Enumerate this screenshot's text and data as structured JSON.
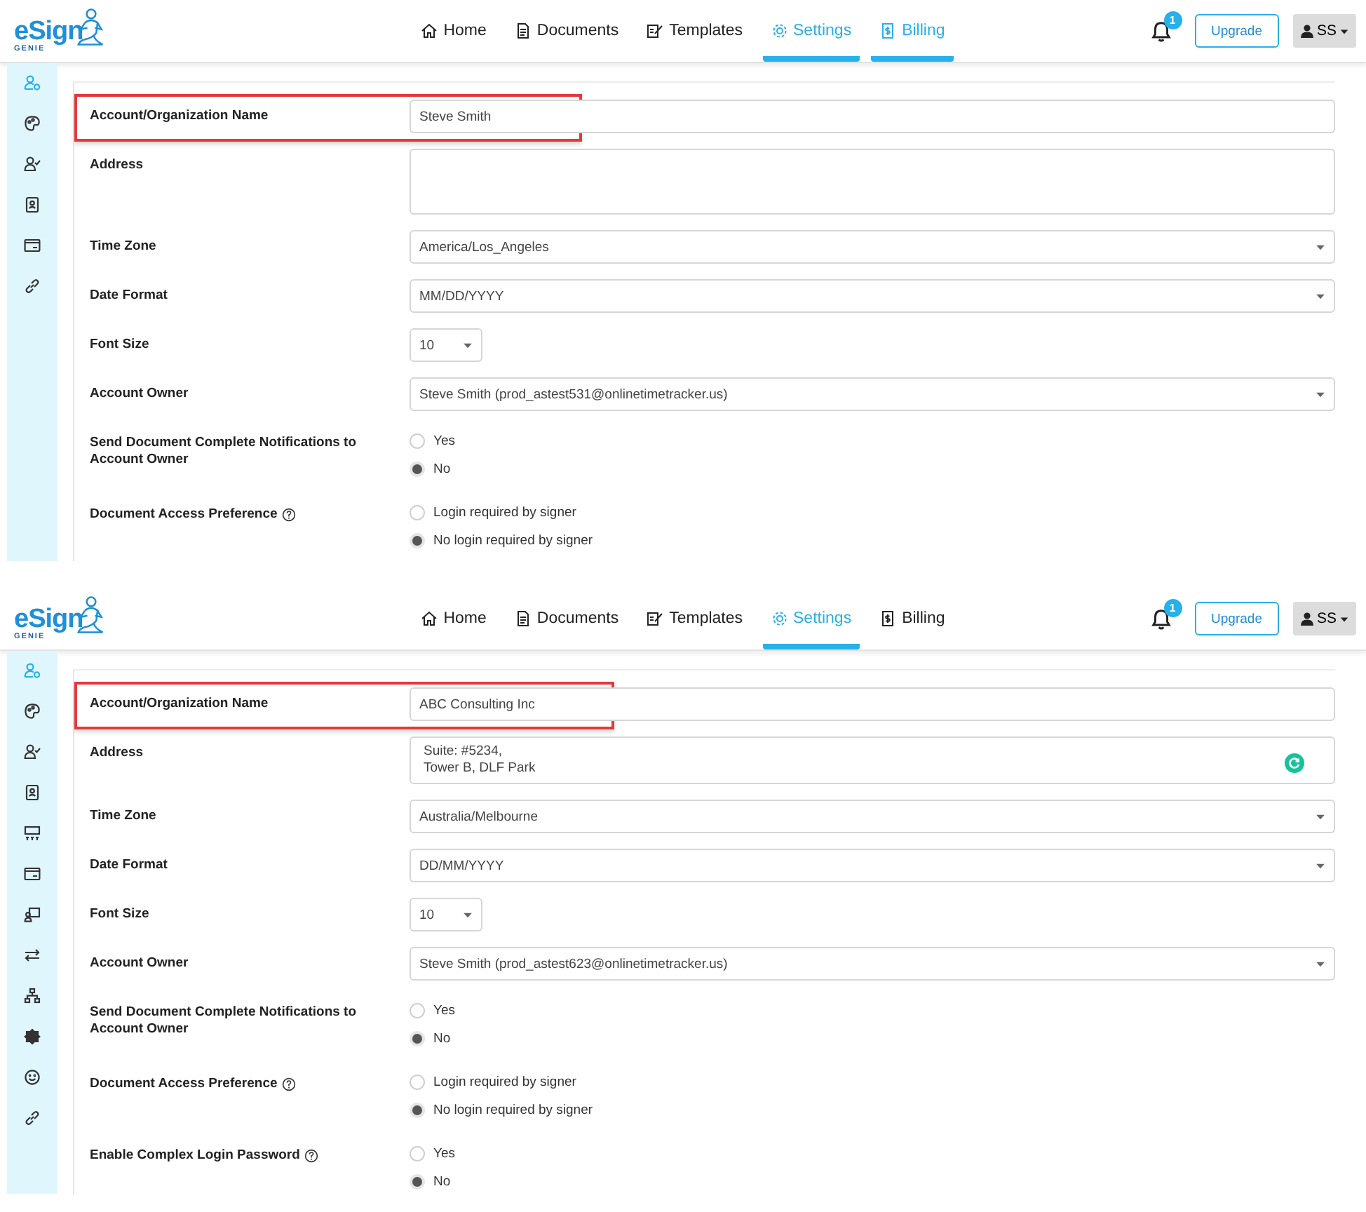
{
  "panels": [
    {
      "logo": {
        "name": "eSign",
        "tagline": "GENIE"
      },
      "nav": [
        {
          "kind": "home",
          "label": "Home",
          "selected": false
        },
        {
          "kind": "document",
          "label": "Documents",
          "selected": false
        },
        {
          "kind": "template",
          "label": "Templates",
          "selected": false
        },
        {
          "kind": "settings",
          "label": "Settings",
          "selected": true
        },
        {
          "kind": "billing",
          "label": "Billing",
          "selected": true
        }
      ],
      "notifications": "1",
      "upgrade": "Upgrade",
      "user": "SS",
      "sidebar": [
        {
          "kind": "user-gear",
          "selected": true
        },
        {
          "kind": "palette",
          "selected": false
        },
        {
          "kind": "user-check",
          "selected": false
        },
        {
          "kind": "contact",
          "selected": false
        },
        {
          "kind": "card",
          "selected": false
        },
        {
          "kind": "link",
          "selected": false
        }
      ],
      "fields": [
        {
          "kind": "text",
          "label": "Account/Organization Name",
          "value": "Steve Smith",
          "highlighted": true,
          "help": false
        },
        {
          "kind": "textarea",
          "label": "Address",
          "assist_badge": false,
          "highlighted": false,
          "help": false
        },
        {
          "kind": "select",
          "label": "Time Zone",
          "value": "America/Los_Angeles",
          "highlighted": false,
          "help": false
        },
        {
          "kind": "select",
          "label": "Date Format",
          "value": "MM/DD/YYYY",
          "highlighted": false,
          "help": false
        },
        {
          "kind": "small-select",
          "label": "Font Size",
          "value": "10",
          "highlighted": false,
          "help": false
        },
        {
          "kind": "select",
          "label": "Account Owner",
          "value": "Steve Smith (prod_astest531@onlinetimetracker.us)",
          "highlighted": false,
          "help": false
        },
        {
          "kind": "radio",
          "label": "Send Document Complete Notifications to Account Owner",
          "highlighted": false,
          "help": false,
          "options": [
            {
              "label": "Yes",
              "selected": false
            },
            {
              "label": "No",
              "selected": true
            }
          ]
        },
        {
          "kind": "radio",
          "label": "Document Access Preference",
          "highlighted": false,
          "help": true,
          "options": [
            {
              "label": "Login required by signer",
              "selected": false
            },
            {
              "label": "No login required by signer",
              "selected": true
            }
          ]
        }
      ]
    },
    {
      "logo": {
        "name": "eSign",
        "tagline": "GENIE"
      },
      "nav": [
        {
          "kind": "home",
          "label": "Home",
          "selected": false
        },
        {
          "kind": "document",
          "label": "Documents",
          "selected": false
        },
        {
          "kind": "template",
          "label": "Templates",
          "selected": false
        },
        {
          "kind": "settings",
          "label": "Settings",
          "selected": true
        },
        {
          "kind": "billing",
          "label": "Billing",
          "selected": false
        }
      ],
      "notifications": "1",
      "upgrade": "Upgrade",
      "user": "SS",
      "sidebar": [
        {
          "kind": "user-gear",
          "selected": true
        },
        {
          "kind": "palette",
          "selected": false
        },
        {
          "kind": "user-check",
          "selected": false
        },
        {
          "kind": "contact",
          "selected": false
        },
        {
          "kind": "team",
          "selected": false
        },
        {
          "kind": "card",
          "selected": false
        },
        {
          "kind": "monitor-user",
          "selected": false
        },
        {
          "kind": "arrows",
          "selected": false
        },
        {
          "kind": "sitemap",
          "selected": false
        },
        {
          "kind": "badge",
          "selected": false
        },
        {
          "kind": "smiley",
          "selected": false
        },
        {
          "kind": "link",
          "selected": false
        }
      ],
      "fields": [
        {
          "kind": "text",
          "label": "Account/Organization Name",
          "value": "ABC Consulting Inc",
          "highlighted": true,
          "help": false
        },
        {
          "kind": "textarea",
          "label": "Address",
          "lines": [
            "Suite: #5234,",
            "Tower B, DLF Park"
          ],
          "assist_badge": true,
          "highlighted": false,
          "help": false
        },
        {
          "kind": "select",
          "label": "Time Zone",
          "value": "Australia/Melbourne",
          "highlighted": false,
          "help": false
        },
        {
          "kind": "select",
          "label": "Date Format",
          "value": "DD/MM/YYYY",
          "highlighted": false,
          "help": false
        },
        {
          "kind": "small-select",
          "label": "Font Size",
          "value": "10",
          "highlighted": false,
          "help": false
        },
        {
          "kind": "select",
          "label": "Account Owner",
          "value": "Steve Smith (prod_astest623@onlinetimetracker.us)",
          "highlighted": false,
          "help": false
        },
        {
          "kind": "radio",
          "label": "Send Document Complete Notifications to Account Owner",
          "highlighted": false,
          "help": false,
          "options": [
            {
              "label": "Yes",
              "selected": false
            },
            {
              "label": "No",
              "selected": true
            }
          ]
        },
        {
          "kind": "radio",
          "label": "Document Access Preference",
          "highlighted": false,
          "help": true,
          "options": [
            {
              "label": "Login required by signer",
              "selected": false
            },
            {
              "label": "No login required by signer",
              "selected": true
            }
          ]
        },
        {
          "kind": "radio",
          "label": "Enable Complex Login Password",
          "highlighted": false,
          "help": true,
          "options": [
            {
              "label": "Yes",
              "selected": false
            },
            {
              "label": "No",
              "selected": true
            }
          ]
        }
      ]
    }
  ]
}
